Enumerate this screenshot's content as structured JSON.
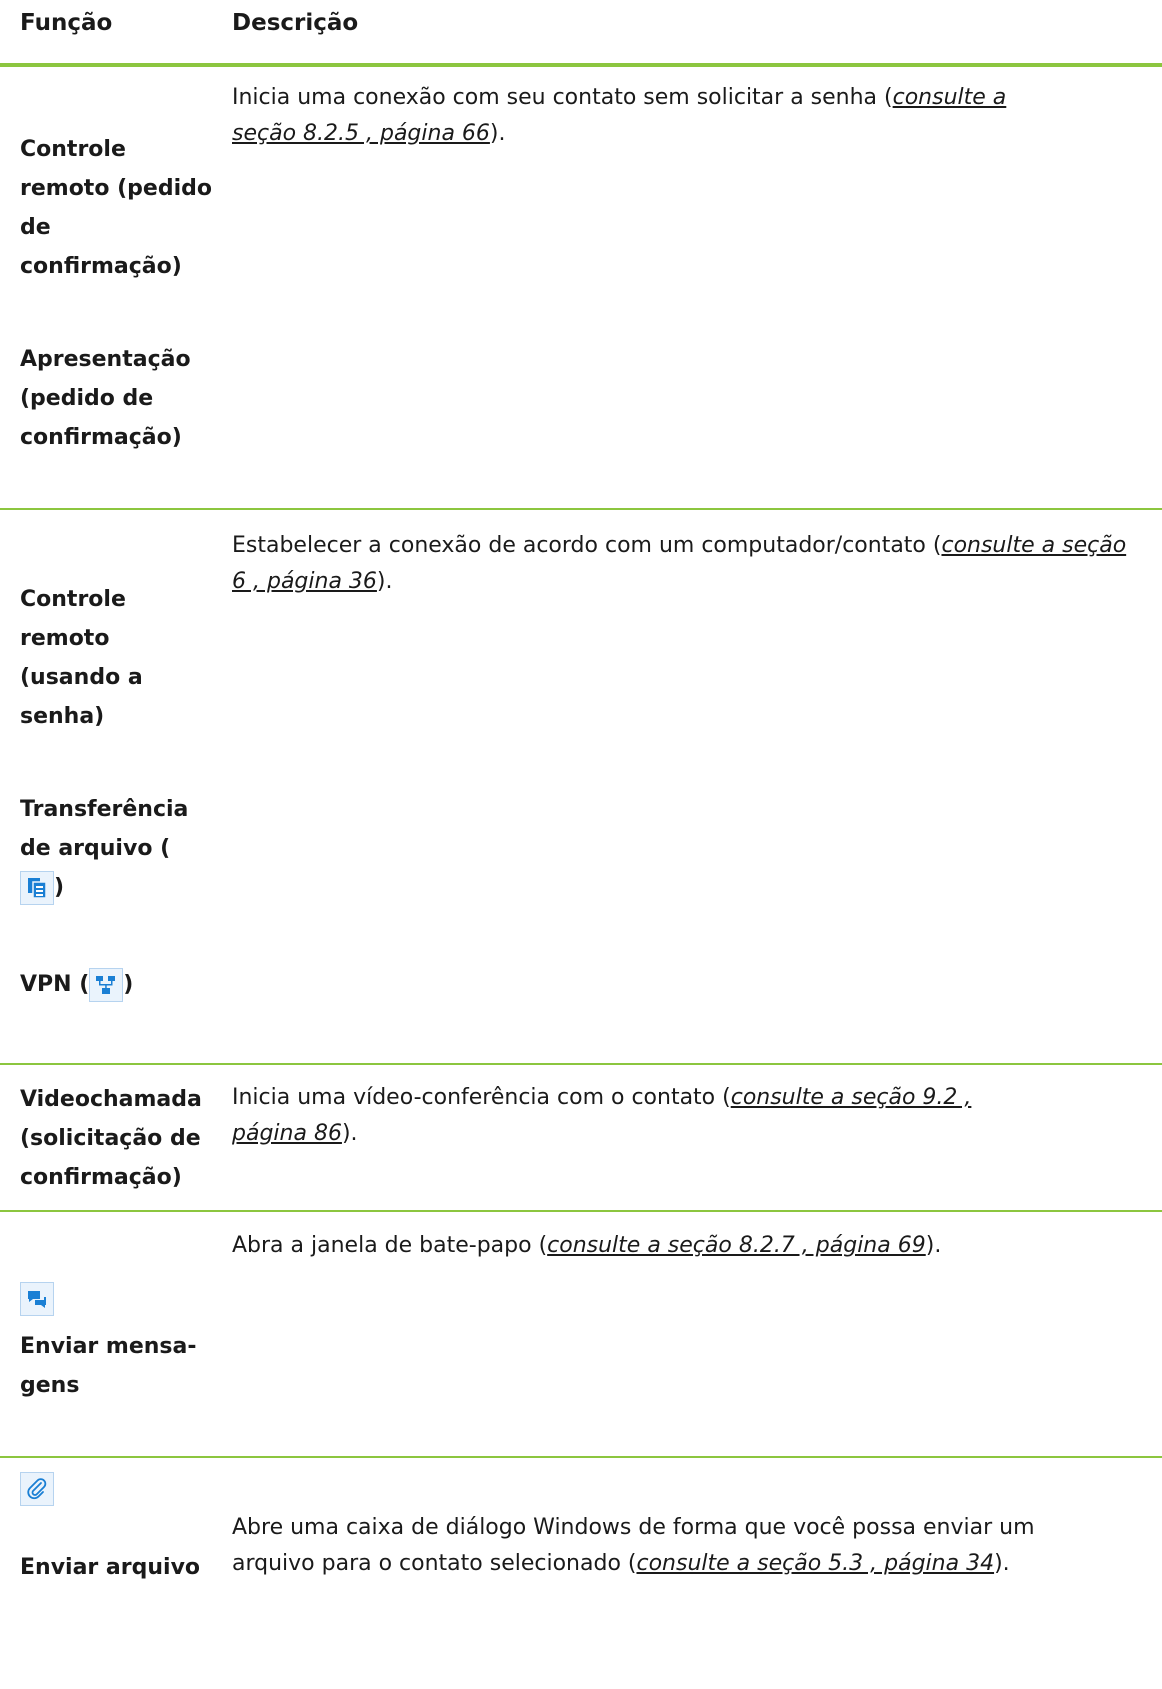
{
  "header": {
    "col_function": "Função",
    "col_description": "Descrição"
  },
  "rows": [
    {
      "functions": [
        "Controle remoto (pedido de confirmação)",
        "Apresentação (pedido de confirmação)"
      ],
      "desc_text": "Inicia uma conexão com seu contato sem solicitar a senha (",
      "desc_ref": "consulte a seção 8.2.5 , página 66",
      "desc_end": ")."
    },
    {
      "functions": [
        "Controle remoto (usando a senha)",
        "Transferência de arquivo (",
        "VPN ("
      ],
      "function_icons": [
        "file-transfer-icon",
        "vpn-network-icon"
      ],
      "desc_text": "Estabelecer a conexão de acordo com um computador/contato (",
      "desc_ref": "consulte a seção 6 , página 36",
      "desc_end": ")."
    },
    {
      "functions": [
        "Videochamada (solicitação de confirmação)"
      ],
      "desc_text": "Inicia uma vídeo-conferência com o contato (",
      "desc_ref": "consulte a seção 9.2 , página 86",
      "desc_end": ")."
    },
    {
      "functions": [
        "Enviar mensa- gens"
      ],
      "function_icons": [
        "chat-icon"
      ],
      "desc_text": "Abra a janela de bate-papo (",
      "desc_ref": "consulte a seção 8.2.7 , página 69",
      "desc_end": ")."
    },
    {
      "functions": [
        "Enviar arquivo"
      ],
      "function_icons": [
        "paperclip-icon"
      ],
      "desc_text": "Abre uma caixa de diálogo Windows de forma que você possa enviar um arquivo para o contato selecionado (",
      "desc_ref": "consulte a seção 5.3 , página 34",
      "desc_end": ")."
    }
  ],
  "colors": {
    "accent": "#8cc63f",
    "icon_blue": "#1a7fd4"
  }
}
